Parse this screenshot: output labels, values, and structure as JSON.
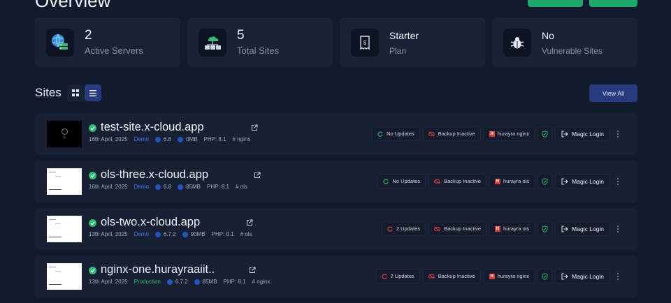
{
  "header": {
    "title": "Overview"
  },
  "stats": [
    {
      "value": "2",
      "label": "Active Servers",
      "icon": "server-globe-icon"
    },
    {
      "value": "5",
      "label": "Total Sites",
      "icon": "cloud-network-icon"
    },
    {
      "value": "Starter",
      "label": "Plan",
      "icon": "receipt-icon"
    },
    {
      "value": "No",
      "label": "Vulnerable Sites",
      "icon": "bug-icon"
    }
  ],
  "sites_section": {
    "title": "Sites",
    "view_all_label": "View All"
  },
  "sites": [
    {
      "name": "test-site.x-cloud.app",
      "date": "16th April, 2025",
      "env": "Demo",
      "wp_version": "6.8",
      "size": "0MB",
      "php": "PHP: 8.1",
      "stack": "# nginx",
      "updates": "No Updates",
      "backup": "Backup Inactive",
      "server": "hurayra nginx",
      "magic_login": "Magic Login",
      "thumb": "dark",
      "update_status": "ok"
    },
    {
      "name": "ols-three.x-cloud.app",
      "date": "16th April, 2025",
      "env": "Demo",
      "wp_version": "6.8",
      "size": "85MB",
      "php": "PHP: 8.1",
      "stack": "# ols",
      "updates": "No Updates",
      "backup": "Backup Inactive",
      "server": "hurayra ols",
      "magic_login": "Magic Login",
      "thumb": "light",
      "update_status": "ok"
    },
    {
      "name": "ols-two.x-cloud.app",
      "date": "13th April, 2025",
      "env": "Demo",
      "wp_version": "6.7.2",
      "size": "90MB",
      "php": "PHP: 8.1",
      "stack": "# ols",
      "updates": "2 Updates",
      "backup": "Backup Inactive",
      "server": "hurayra ols",
      "magic_login": "Magic Login",
      "thumb": "light",
      "update_status": "pending"
    },
    {
      "name": "nginx-one.hurayraaiit..",
      "date": "13th April, 2025",
      "env": "Production",
      "wp_version": "6.7.2",
      "size": "85MB",
      "php": "PHP: 8.1",
      "stack": "# nginx",
      "updates": "2 Updates",
      "backup": "Backup Inactive",
      "server": "hurayra nginx",
      "magic_login": "Magic Login",
      "thumb": "light",
      "update_status": "pending"
    }
  ],
  "colors": {
    "background": "#141a2e",
    "card": "#1b2236",
    "accent": "#283a80",
    "success": "#2cbf73",
    "danger": "#d93b3b",
    "demo": "#3d7ae8"
  }
}
